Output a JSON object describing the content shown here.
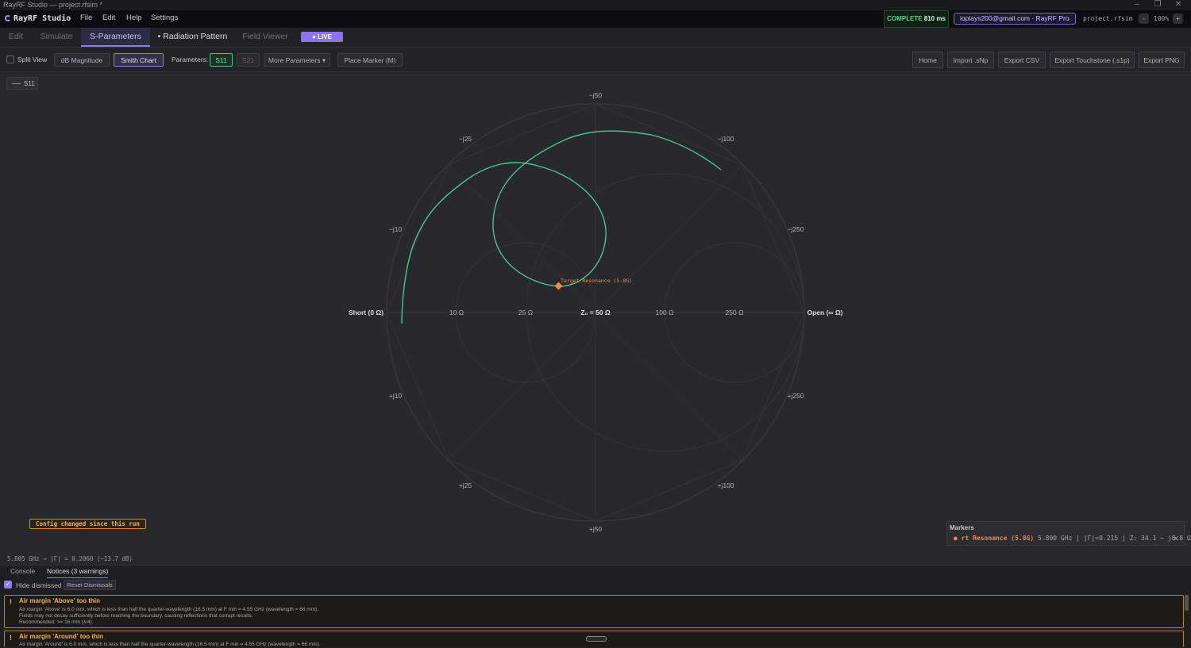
{
  "window": {
    "title": "RayRF Studio — project.rfsim *"
  },
  "menubar": {
    "app_name": "RayRF Studio",
    "menus": [
      "File",
      "Edit",
      "Help",
      "Settings"
    ],
    "status_label": "COMPLETE",
    "status_time": "810 ms",
    "account": "ioplays200@gmail.com · RayRF Pro",
    "project": "project.rfsim",
    "zoom_out": "-",
    "zoom": "100%",
    "zoom_in": "+"
  },
  "tabs": [
    "Edit",
    "Simulate",
    "S-Parameters",
    "• Radiation Pattern",
    "Field Viewer"
  ],
  "live_badge": "● LIVE",
  "toolbar": {
    "split_view": "Split View",
    "db_magnitude": "dB Magnitude",
    "smith_chart": "Smith Chart",
    "parameters_label": "Parameters:",
    "s11": "S11",
    "s21": "S21",
    "more_params": "More Parameters ▾",
    "place_marker": "Place Marker (M)",
    "home": "Home",
    "import_snp": "Import .sNp",
    "export_csv": "Export CSV",
    "export_touchstone": "Export Touchstone (.s1p)",
    "export_png": "Export PNG"
  },
  "legend": {
    "label": "S11"
  },
  "smith": {
    "top_label": "−j50",
    "bottom_label": "+j50",
    "labels_upper": [
      "−j25",
      "−j100",
      "−j10",
      "−j250"
    ],
    "labels_lower": [
      "+j10",
      "+j250",
      "+j25",
      "+j100"
    ],
    "axis_labels": [
      "Short (0 Ω)",
      "10 Ω",
      "25 Ω",
      "Z₀ = 50 Ω",
      "100 Ω",
      "250 Ω",
      "Open (∞ Ω)"
    ],
    "marker_label": "Target Resonance (5.8G)",
    "trace_color": "#4cc38a",
    "marker_color": "#ee8a4f"
  },
  "config_notice": "Config changed since this run",
  "markers_panel": {
    "title": "Markers",
    "name": "rt Resonance (5.8G)",
    "details": "5.800 GHz  |  |Γ|=0.215  |  Z: 34.1 − j8.8 Ω",
    "close": "✕"
  },
  "readout": "5.805 GHz → |Γ| = 0.2060 (−13.7 dB)",
  "bottom": {
    "tabs": [
      "Console",
      "Notices (3 warnings)"
    ],
    "hide_dismissed": "Hide dismissed",
    "reset": "Reset Dismissals",
    "notices": [
      {
        "title": "Air margin 'Above' too thin",
        "lines": [
          "Air margin 'Above' is 6.0 mm, which is less than half the quarter-wavelength (16.5 mm) at F min = 4.55 GHz (wavelength = 66 mm).",
          "Fields may not decay sufficiently before reaching the boundary, causing reflections that corrupt results.",
          "Recommended: >= 16 mm (λ/4)."
        ]
      },
      {
        "title": "Air margin 'Around' too thin",
        "lines": [
          "Air margin 'Around' is 6.0 mm, which is less than half the quarter-wavelength (16.5 mm) at F min = 4.55 GHz (wavelength = 66 mm)."
        ]
      }
    ]
  }
}
